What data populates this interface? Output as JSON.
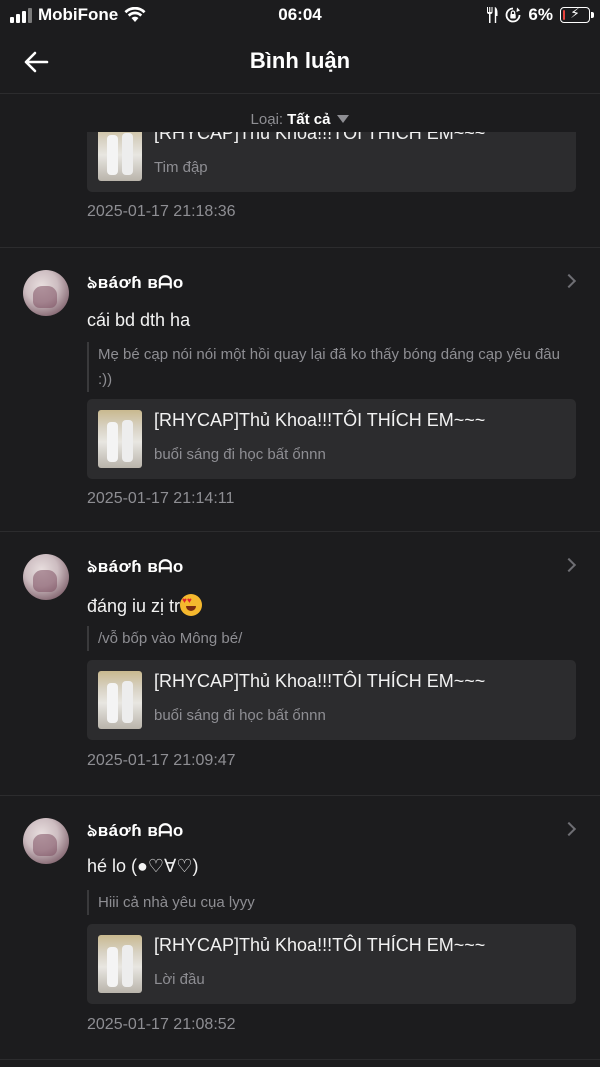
{
  "status_bar": {
    "carrier": "MobiFone",
    "time": "06:04",
    "battery_percent": "6%",
    "battery_level": 0.06,
    "icons": [
      "cellular-signal-icon",
      "wifi-icon",
      "fork-knife-icon",
      "rotation-lock-icon",
      "battery-charging-icon"
    ]
  },
  "header": {
    "title": "Bình luận",
    "back_icon": "arrow-left-icon"
  },
  "filter": {
    "label": "Loại:",
    "value": "Tất cả"
  },
  "comments": [
    {
      "card": {
        "title": "[RHYCAP]Thủ Khoa!!!TÔI THÍCH EM~~~",
        "subtitle": "Tim đập"
      },
      "time": "2025-01-17 21:18:36"
    },
    {
      "user": "ঌʙáơɦ ʙᗩo",
      "text": "cái bd dth ha",
      "quote": "Mẹ bé cạp nói nói một hồi quay lại đã ko thấy bóng dáng cạp yêu đâu :))",
      "card": {
        "title": "[RHYCAP]Thủ Khoa!!!TÔI THÍCH EM~~~",
        "subtitle": "buổi sáng đi học bất ổnnn"
      },
      "time": "2025-01-17 21:14:11"
    },
    {
      "user": "ঌʙáơɦ ʙᗩo",
      "text": "đáng iu zị tr",
      "text_emoji": "heart-eyes-emoji",
      "quote": "/vỗ bốp vào Mông bé/",
      "card": {
        "title": "[RHYCAP]Thủ Khoa!!!TÔI THÍCH EM~~~",
        "subtitle": "buổi sáng đi học bất ổnnn"
      },
      "time": "2025-01-17 21:09:47"
    },
    {
      "user": "ঌʙáơɦ ʙᗩo",
      "text": "hé lo (●♡∀♡)",
      "quote": "Hiii cả nhà yêu cụa lyyy",
      "card": {
        "title": "[RHYCAP]Thủ Khoa!!!TÔI THÍCH EM~~~",
        "subtitle": "Lời đầu"
      },
      "time": "2025-01-17 21:08:52"
    }
  ]
}
